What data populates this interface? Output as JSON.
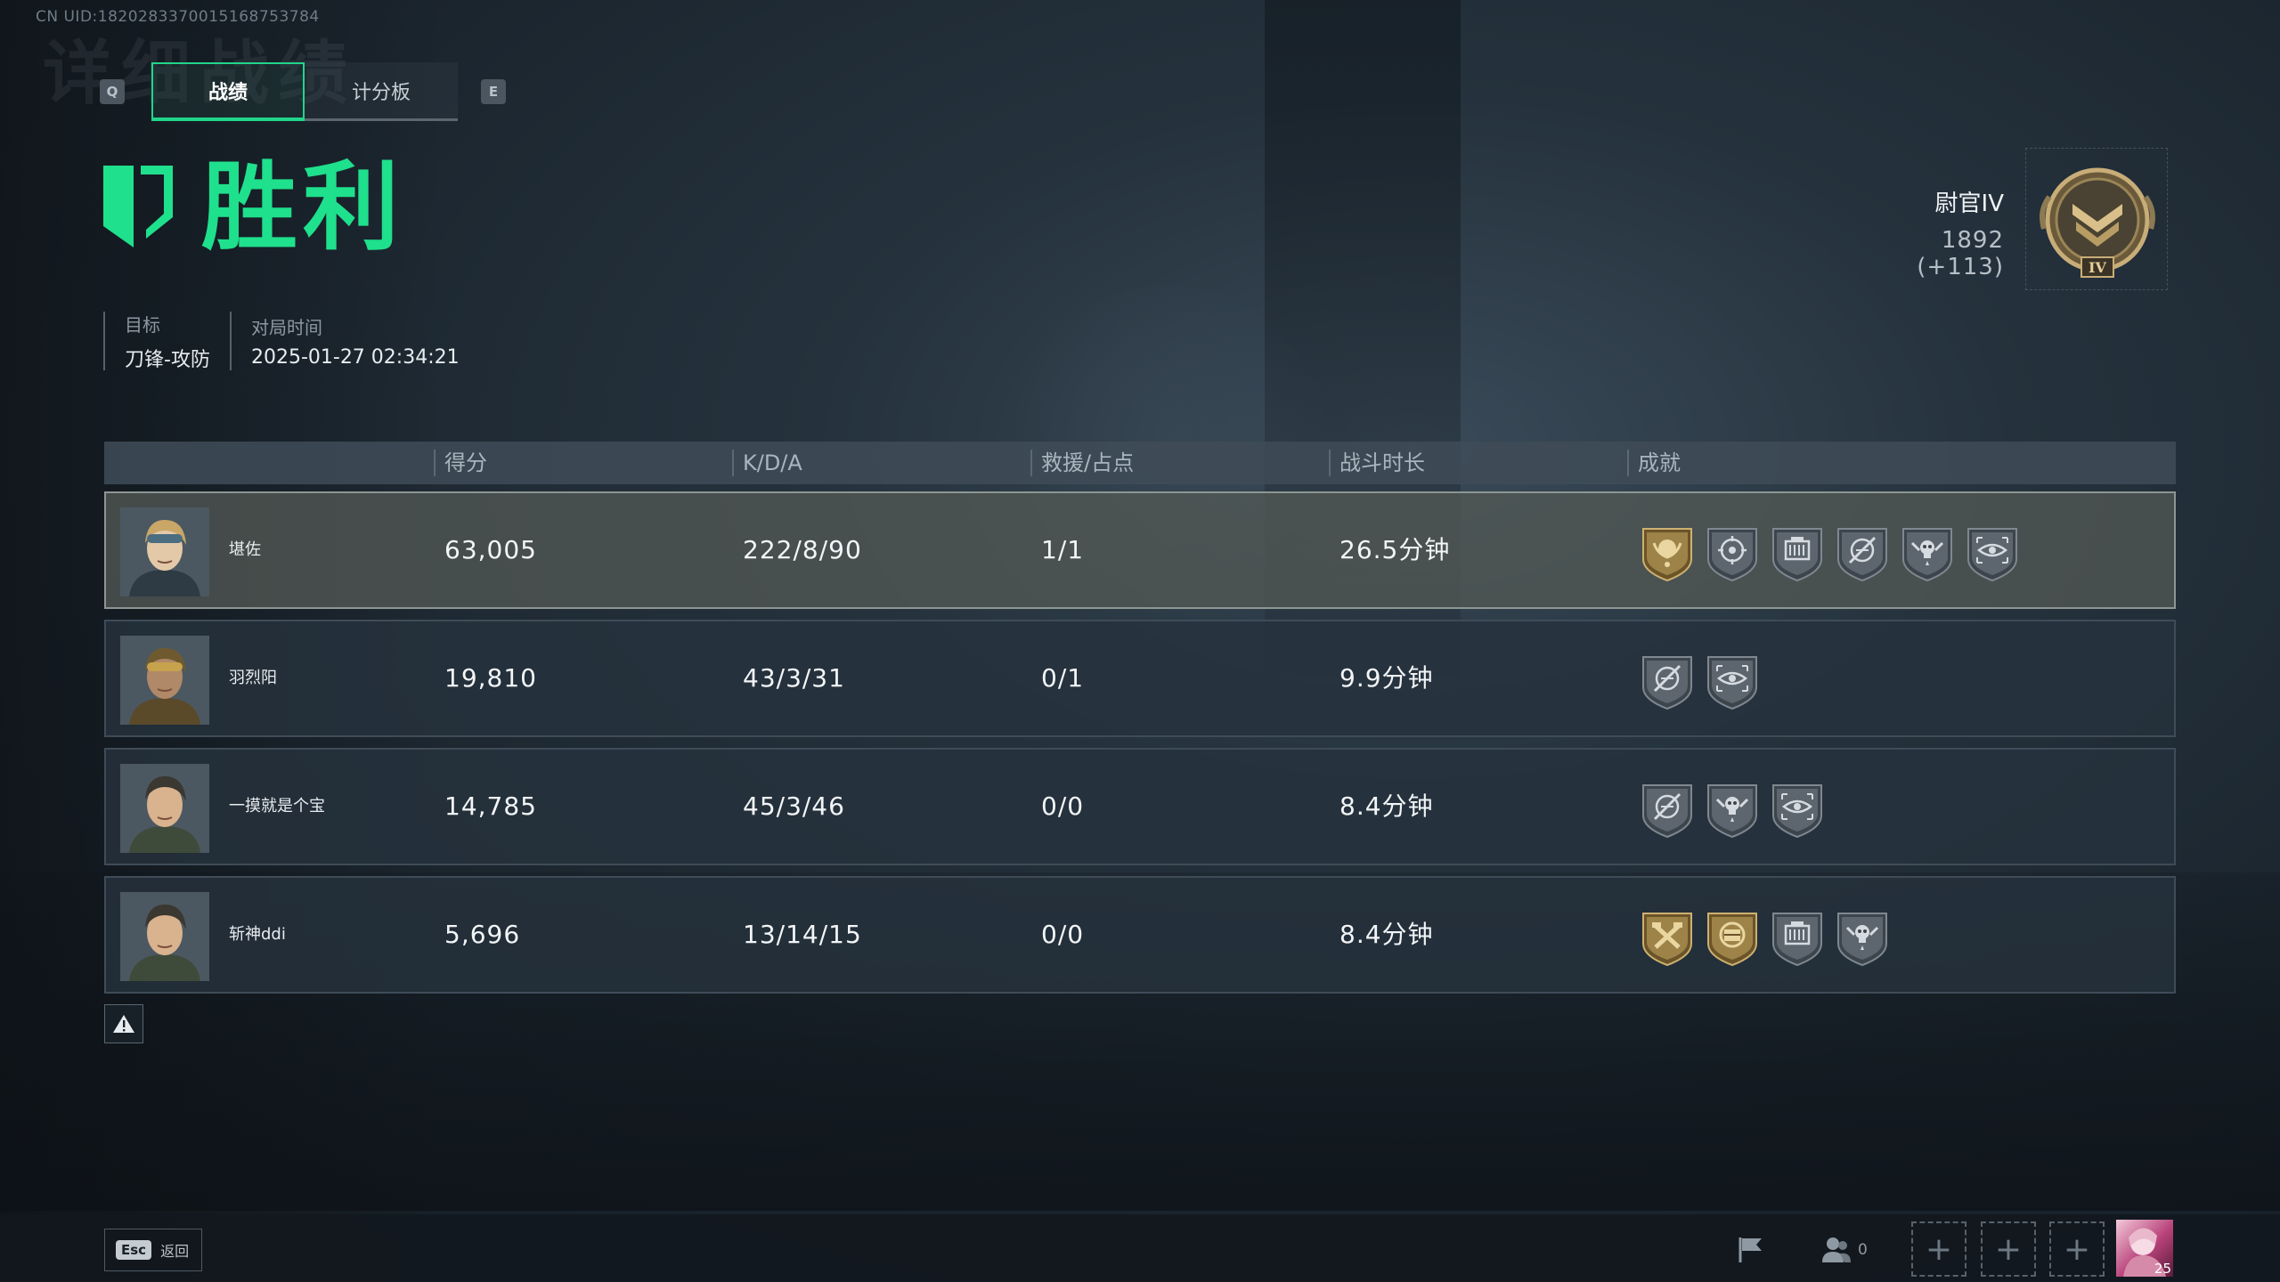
{
  "header": {
    "uid": "CN UID:1820283370015168753784",
    "ghost_title": "详细战绩"
  },
  "tabs": {
    "left_key": "Q",
    "right_key": "E",
    "items": [
      {
        "label": "战绩",
        "active": true
      },
      {
        "label": "计分板",
        "active": false
      }
    ]
  },
  "result": {
    "title": "胜利",
    "color": "#1fe08c"
  },
  "meta": {
    "target_label": "目标",
    "target_value": "刀锋-攻防",
    "time_label": "对局时间",
    "time_value": "2025-01-27 02:34:21"
  },
  "rank": {
    "name": "尉官IV",
    "score": "1892 (+113)",
    "badge_icon": "rank-badge-icon"
  },
  "table": {
    "headers": {
      "score": "得分",
      "kda": "K/D/A",
      "rescue": "救援/占点",
      "duration": "战斗时长",
      "achievements": "成就"
    },
    "rows": [
      {
        "name": "堪佐",
        "score": "63,005",
        "kda": "222/8/90",
        "rescue": "1/1",
        "duration": "26.5分钟",
        "me": true,
        "achievements": [
          "gold-medal-icon",
          "target-icon",
          "ammo-crate-icon",
          "no-aim-icon",
          "skull-wings-icon",
          "eye-scope-icon"
        ]
      },
      {
        "name": "羽烈阳",
        "score": "19,810",
        "kda": "43/3/31",
        "rescue": "0/1",
        "duration": "9.9分钟",
        "me": false,
        "achievements": [
          "no-aim-icon",
          "eye-scope-icon"
        ]
      },
      {
        "name": "一摸就是个宝",
        "score": "14,785",
        "kda": "45/3/46",
        "rescue": "0/0",
        "duration": "8.4分钟",
        "me": false,
        "achievements": [
          "no-aim-icon",
          "skull-wings-icon",
          "eye-scope-icon"
        ]
      },
      {
        "name": "斩神ddi",
        "score": "5,696",
        "kda": "13/14/15",
        "rescue": "0/0",
        "duration": "8.4分钟",
        "me": false,
        "achievements": [
          "gold-hammer-icon",
          "gold-chest-icon",
          "ammo-crate-icon",
          "skull-wings-icon"
        ]
      }
    ]
  },
  "footer": {
    "esc_key": "Esc",
    "esc_label": "返回",
    "party_count": "0",
    "avatar_level": "25"
  }
}
